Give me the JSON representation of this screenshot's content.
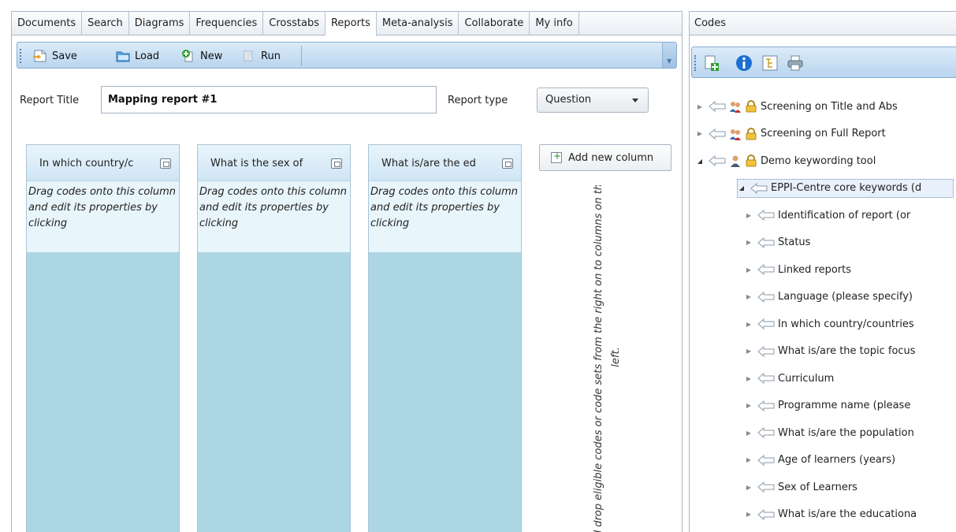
{
  "tabs": [
    {
      "label": "Documents",
      "active": false
    },
    {
      "label": "Search",
      "active": false
    },
    {
      "label": "Diagrams",
      "active": false
    },
    {
      "label": "Frequencies",
      "active": false
    },
    {
      "label": "Crosstabs",
      "active": false
    },
    {
      "label": "Reports",
      "active": true
    },
    {
      "label": "Meta-analysis",
      "active": false
    },
    {
      "label": "Collaborate",
      "active": false
    },
    {
      "label": "My info",
      "active": false
    }
  ],
  "toolbar": {
    "save": "Save",
    "load": "Load",
    "new": "New",
    "run": "Run"
  },
  "report": {
    "title_label": "Report Title",
    "title_value": "Mapping report #1",
    "type_label": "Report type",
    "type_value": "Question"
  },
  "columns": [
    {
      "header": "In which country/c",
      "desc": "Drag codes onto this column and edit its properties by clicking"
    },
    {
      "header": "What is the sex of",
      "desc": "Drag codes onto this column and edit its properties by clicking"
    },
    {
      "header": "What is/are the ed",
      "desc": "Drag codes onto this column and edit its properties by clicking"
    }
  ],
  "add_column": "Add new column",
  "drop_hint": "d drop eligible codes or code sets from the right on to columns on the left.",
  "codes": {
    "title": "Codes",
    "toolbar_icons": [
      "add-code-set-icon",
      "info-icon",
      "tree-view-icon",
      "print-icon"
    ],
    "tree": [
      {
        "label": "Screening on Title and Abs",
        "level": 0,
        "kind": "set-shared"
      },
      {
        "label": "Screening on Full Report",
        "level": 0,
        "kind": "set-shared"
      },
      {
        "label": "Demo keywording tool",
        "level": 0,
        "kind": "set-single",
        "expanded": true
      },
      {
        "label": "EPPI-Centre core keywords (d",
        "level": 1,
        "kind": "code",
        "expanded": true,
        "selected": true
      },
      {
        "label": "Identification of report (or",
        "level": 2,
        "kind": "code"
      },
      {
        "label": "Status",
        "level": 2,
        "kind": "code"
      },
      {
        "label": "Linked reports",
        "level": 2,
        "kind": "code"
      },
      {
        "label": "Language (please specify)",
        "level": 2,
        "kind": "code"
      },
      {
        "label": "In which country/countries",
        "level": 2,
        "kind": "code"
      },
      {
        "label": "What is/are the topic focus",
        "level": 2,
        "kind": "code"
      },
      {
        "label": "Curriculum",
        "level": 2,
        "kind": "code"
      },
      {
        "label": "Programme name (please",
        "level": 2,
        "kind": "code"
      },
      {
        "label": "What is/are the population",
        "level": 2,
        "kind": "code"
      },
      {
        "label": "Age of learners (years)",
        "level": 2,
        "kind": "code"
      },
      {
        "label": "Sex of Learners",
        "level": 2,
        "kind": "code"
      },
      {
        "label": "What is/are the educationa",
        "level": 2,
        "kind": "code"
      }
    ]
  },
  "colors": {
    "accent": "#b9d5ee",
    "column_body": "#acd6e4",
    "column_desc": "#e8f5fb"
  }
}
